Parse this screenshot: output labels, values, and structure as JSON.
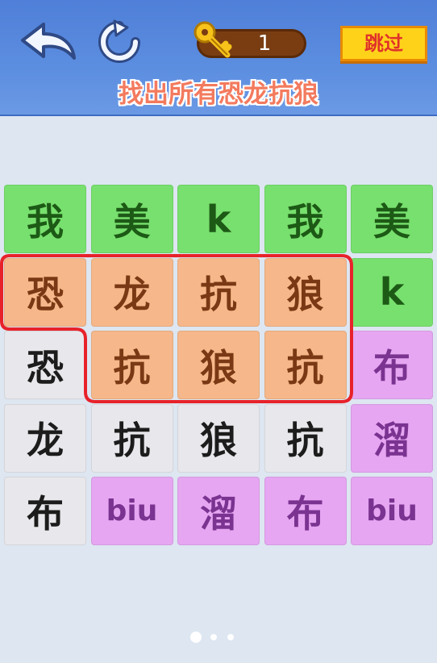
{
  "header": {
    "key_count": "1",
    "skip_label": "跳过",
    "title": "找出所有恐龙抗狼"
  },
  "board": {
    "rows": [
      [
        {
          "text": "我",
          "color": "green"
        },
        {
          "text": "美",
          "color": "green"
        },
        {
          "text": "k",
          "color": "green"
        },
        {
          "text": "我",
          "color": "green"
        },
        {
          "text": "美",
          "color": "green"
        }
      ],
      [
        {
          "text": "恐",
          "color": "orange"
        },
        {
          "text": "龙",
          "color": "orange"
        },
        {
          "text": "抗",
          "color": "orange"
        },
        {
          "text": "狼",
          "color": "orange"
        },
        {
          "text": "k",
          "color": "green"
        }
      ],
      [
        {
          "text": "恐",
          "color": "gray"
        },
        {
          "text": "抗",
          "color": "orange"
        },
        {
          "text": "狼",
          "color": "orange"
        },
        {
          "text": "抗",
          "color": "orange"
        },
        {
          "text": "布",
          "color": "purple"
        }
      ],
      [
        {
          "text": "龙",
          "color": "gray"
        },
        {
          "text": "抗",
          "color": "gray"
        },
        {
          "text": "狼",
          "color": "gray"
        },
        {
          "text": "抗",
          "color": "gray"
        },
        {
          "text": "溜",
          "color": "purple"
        }
      ],
      [
        {
          "text": "布",
          "color": "gray"
        },
        {
          "text": "biu",
          "color": "purple"
        },
        {
          "text": "溜",
          "color": "purple"
        },
        {
          "text": "布",
          "color": "purple"
        },
        {
          "text": "biu",
          "color": "purple"
        }
      ]
    ]
  },
  "pagination": {
    "total": 3,
    "active": 0
  },
  "colors": {
    "selection_outline": "#e8222a",
    "header_bg": "#5c8ee0",
    "skip_bg": "#ffd21a"
  }
}
